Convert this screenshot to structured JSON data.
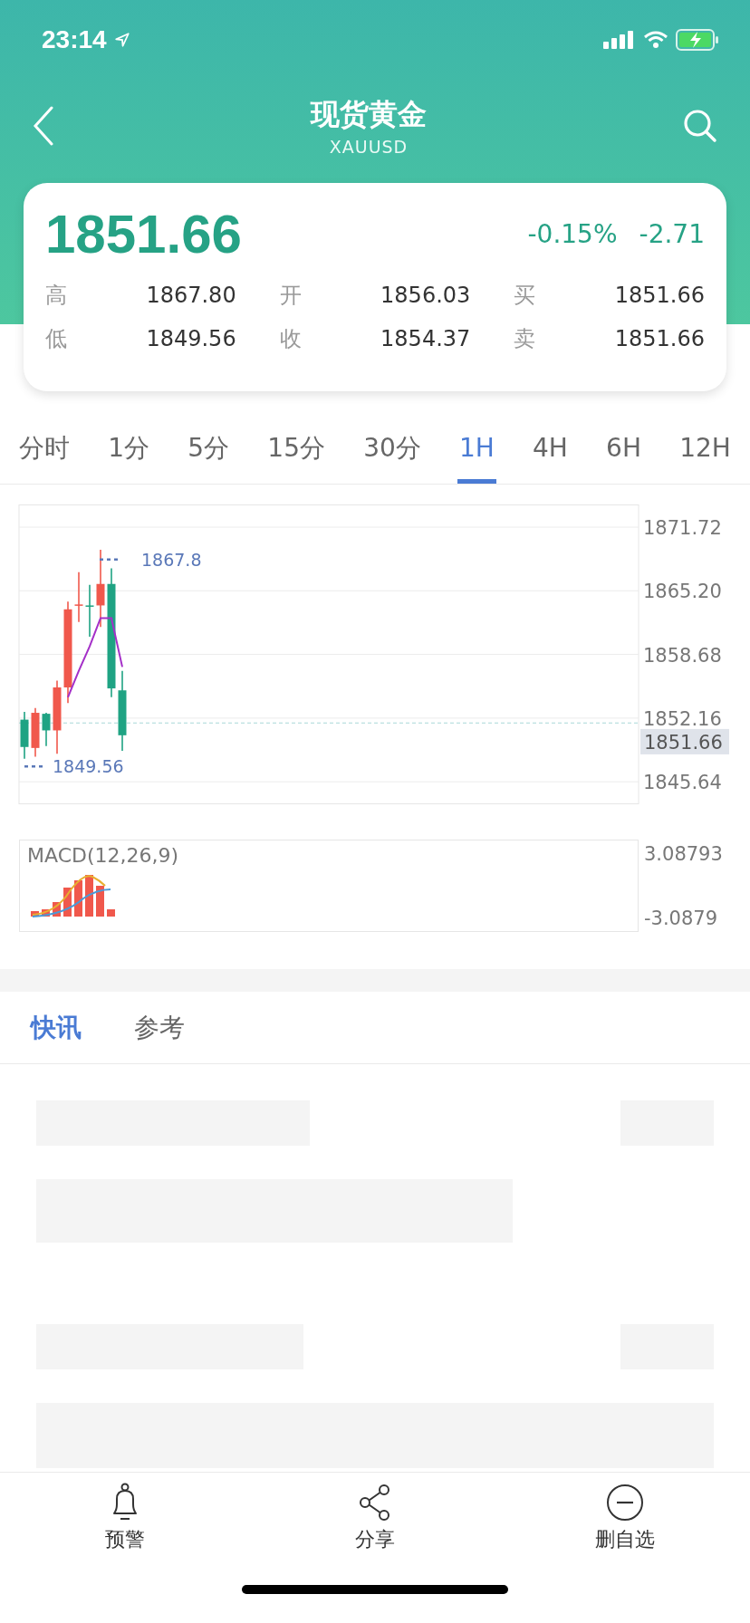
{
  "status_bar": {
    "time": "23:14"
  },
  "header": {
    "title": "现货黄金",
    "subtitle": "XAUUSD"
  },
  "quote": {
    "price": "1851.66",
    "change_pct": "-0.15%",
    "change": "-2.71",
    "stats": [
      {
        "label": "高",
        "value": "1867.80"
      },
      {
        "label": "开",
        "value": "1856.03"
      },
      {
        "label": "买",
        "value": "1851.66"
      },
      {
        "label": "低",
        "value": "1849.56"
      },
      {
        "label": "收",
        "value": "1854.37"
      },
      {
        "label": "卖",
        "value": "1851.66"
      }
    ]
  },
  "period_tabs": [
    {
      "label": "分时",
      "selected": false
    },
    {
      "label": "1分",
      "selected": false
    },
    {
      "label": "5分",
      "selected": false
    },
    {
      "label": "15分",
      "selected": false
    },
    {
      "label": "30分",
      "selected": false
    },
    {
      "label": "1H",
      "selected": true
    },
    {
      "label": "4H",
      "selected": false
    },
    {
      "label": "6H",
      "selected": false
    },
    {
      "label": "12H",
      "selected": false
    }
  ],
  "price_chart": {
    "y_labels": [
      "1871.72",
      "1865.20",
      "1858.68",
      "1852.16",
      "1845.64"
    ],
    "high_label": "1867.8",
    "low_label": "1849.56",
    "last_price": "1851.66"
  },
  "macd": {
    "label": "MACD(12,26,9)",
    "ticks": [
      "3.08793",
      "-3.0879"
    ]
  },
  "news_tabs": [
    {
      "label": "快讯",
      "selected": true
    },
    {
      "label": "参考",
      "selected": false
    }
  ],
  "bottom_bar": [
    {
      "kind": "bell",
      "label": "预警"
    },
    {
      "kind": "share",
      "label": "分享"
    },
    {
      "kind": "remove",
      "label": "删自选"
    }
  ]
}
